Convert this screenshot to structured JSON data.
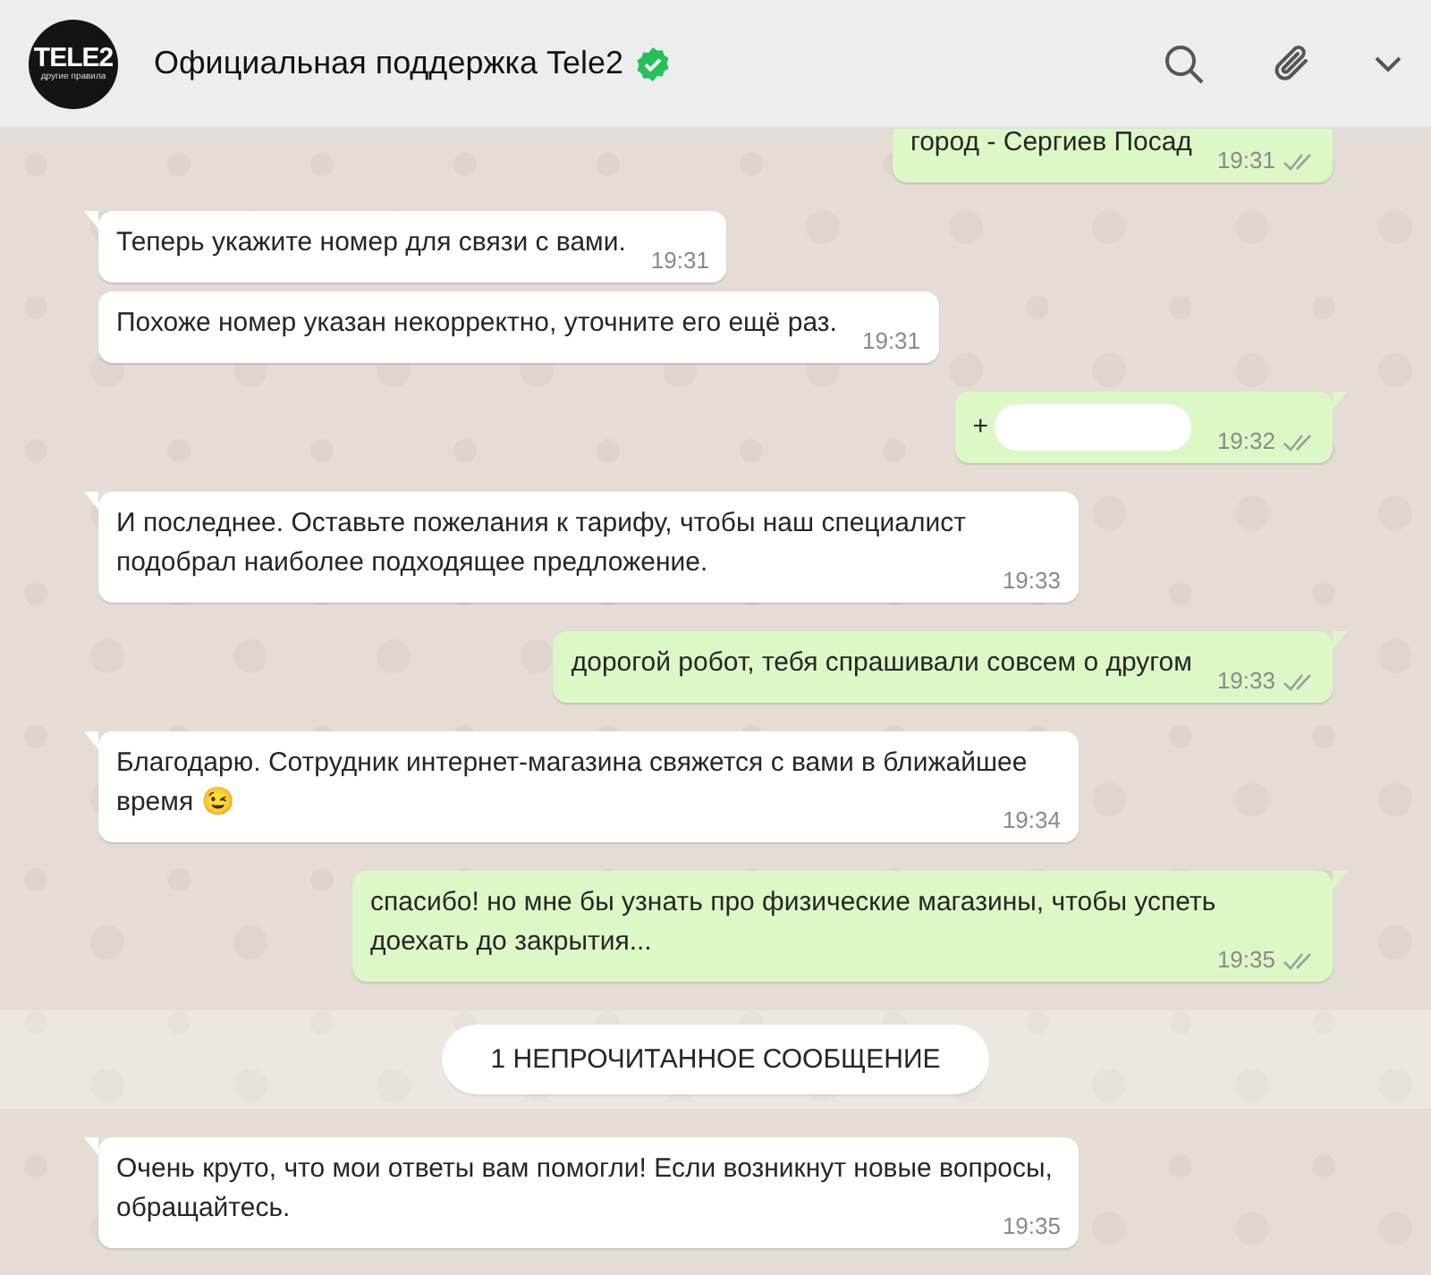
{
  "header": {
    "avatar": {
      "logo": "TELE2",
      "slogan": "другие правила"
    },
    "title": "Официальная поддержка Tele2",
    "verified": true
  },
  "messages": [
    {
      "kind": "out",
      "text": "город - Сергиев Посад",
      "time": "19:31",
      "read": false
    },
    {
      "kind": "in",
      "text": "Теперь укажите номер для связи с вами.",
      "time": "19:31",
      "tail": true
    },
    {
      "kind": "in",
      "text": "Похоже номер указан некорректно, уточните его ещё раз.",
      "time": "19:31",
      "tail": false
    },
    {
      "kind": "out",
      "text": "+",
      "redacted": true,
      "time": "19:32",
      "read": false,
      "tail": true
    },
    {
      "kind": "in",
      "text": "И последнее. Оставьте пожелания к тарифу, чтобы наш специалист подобрал наиболее подходящее предложение.",
      "time": "19:33",
      "tail": true
    },
    {
      "kind": "out",
      "text": "дорогой робот, тебя спрашивали совсем о другом",
      "time": "19:33",
      "read": false,
      "tail": true
    },
    {
      "kind": "in",
      "text": "Благодарю. Сотрудник интернет-магазина свяжется с вами в ближайшее время 😉",
      "time": "19:34",
      "tail": true
    },
    {
      "kind": "out",
      "text": "спасибо! но мне бы узнать про физические магазины, чтобы успеть доехать до закрытия...",
      "time": "19:35",
      "read": false,
      "tail": true
    },
    {
      "kind": "divider",
      "text": "1 НЕПРОЧИТАННОЕ СООБЩЕНИЕ"
    },
    {
      "kind": "in",
      "text": "Очень круто, что мои ответы вам помогли! Если возникнут новые вопросы, обращайтесь.",
      "time": "19:35",
      "tail": true
    }
  ]
}
